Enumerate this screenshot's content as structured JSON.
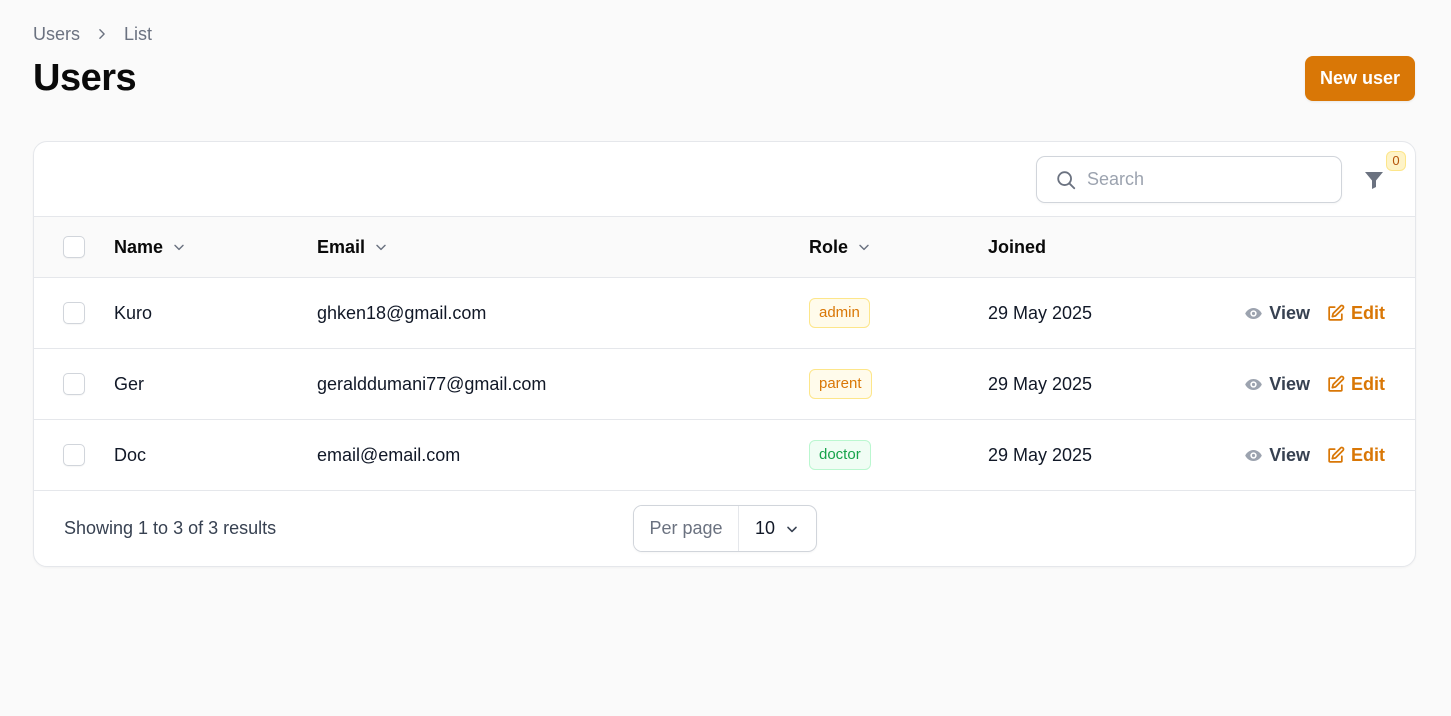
{
  "breadcrumb": {
    "items": [
      "Users",
      "List"
    ]
  },
  "page": {
    "title": "Users"
  },
  "header": {
    "new_button_label": "New user"
  },
  "toolbar": {
    "search_placeholder": "Search",
    "filter_count": "0"
  },
  "table": {
    "columns": [
      {
        "label": "Name",
        "sortable": true
      },
      {
        "label": "Email",
        "sortable": true
      },
      {
        "label": "Role",
        "sortable": true
      },
      {
        "label": "Joined",
        "sortable": false
      }
    ],
    "rows": [
      {
        "name": "Kuro",
        "email": "ghken18@gmail.com",
        "role": "admin",
        "role_color": "#d97706",
        "joined": "29 May 2025"
      },
      {
        "name": "Ger",
        "email": "geralddumani77@gmail.com",
        "role": "parent",
        "role_color": "#d97706",
        "joined": "29 May 2025"
      },
      {
        "name": "Doc",
        "email": "email@email.com",
        "role": "doctor",
        "role_color": "#16a34a",
        "joined": "29 May 2025"
      }
    ],
    "actions": {
      "view_label": "View",
      "edit_label": "Edit"
    }
  },
  "footer": {
    "showing_text": "Showing 1 to 3 of 3 results",
    "per_page_label": "Per page",
    "per_page_value": "10"
  },
  "colors": {
    "accent": "#d97706",
    "success": "#16a34a",
    "background": "#fafafa"
  },
  "icons": [
    "chevron-right-icon",
    "search-icon",
    "filter-icon",
    "chevron-down-icon",
    "eye-icon",
    "edit-icon"
  ]
}
